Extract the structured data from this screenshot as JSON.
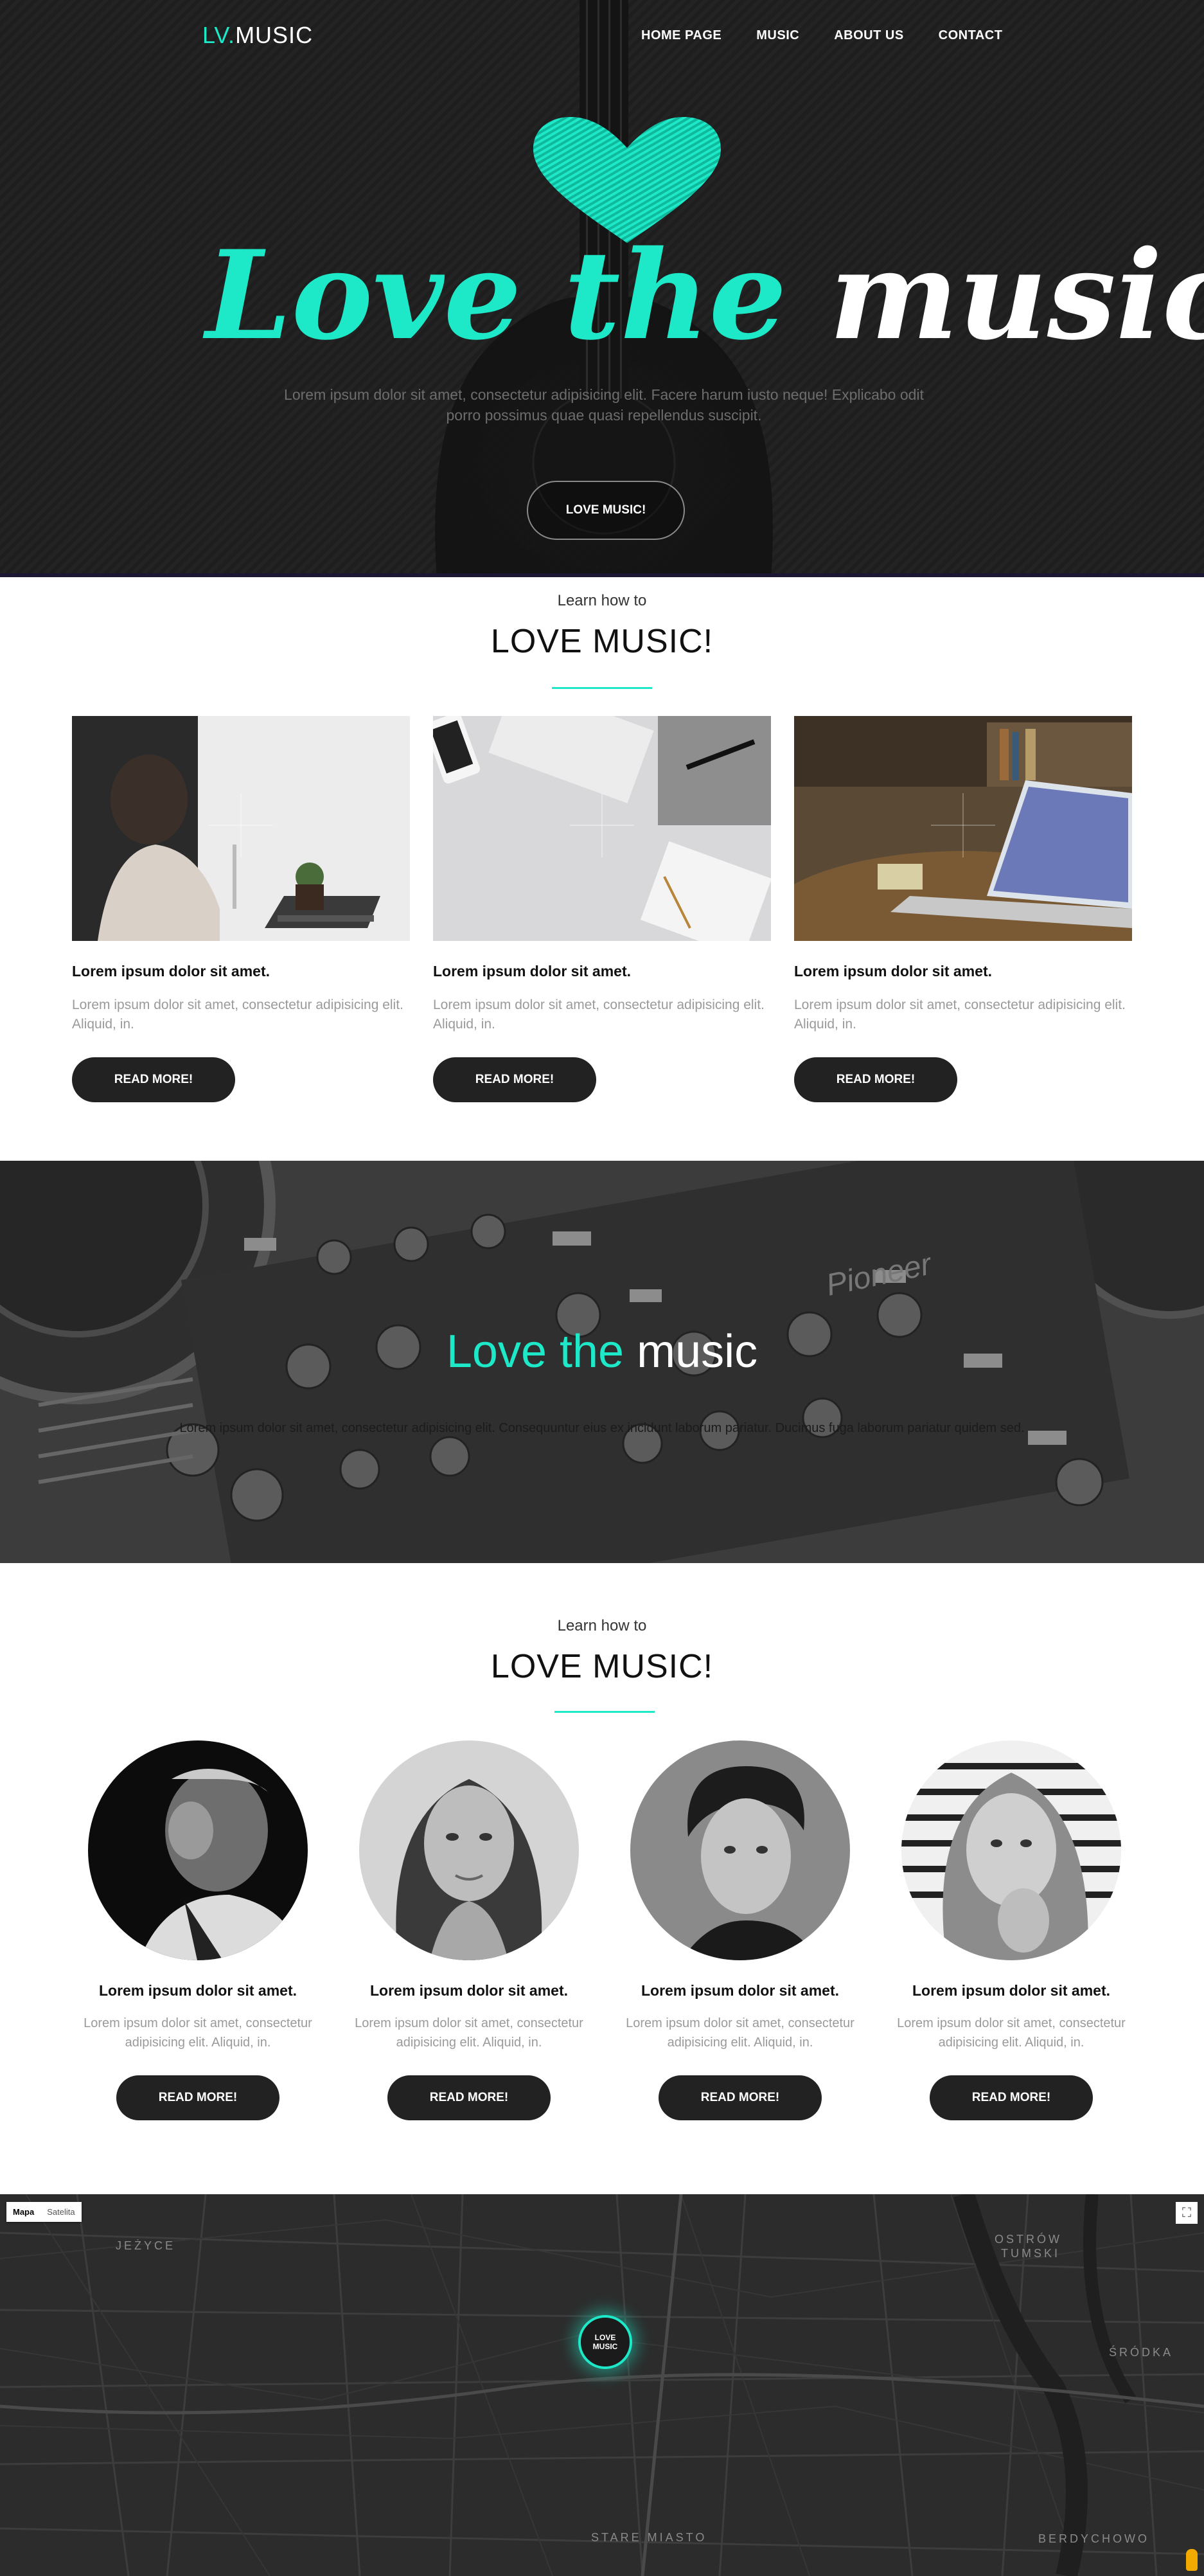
{
  "header": {
    "logo_accent": "LV.",
    "logo_rest": "MUSIC",
    "nav": [
      "HOME PAGE",
      "MUSIC",
      "ABOUT US",
      "CONTACT"
    ]
  },
  "hero": {
    "title_teal": "Love the",
    "title_white": "music",
    "subtitle_line1": "Lorem ipsum dolor sit amet, consectetur adipisicing elit. Facere harum iusto neque! Explicabo odit",
    "subtitle_line2": "porro possimus quae quasi repellendus suscipit.",
    "button": "LOVE MUSIC!"
  },
  "section1": {
    "kicker": "Learn how to",
    "title": "LOVE MUSIC!",
    "cards": [
      {
        "title": "Lorem ipsum dolor sit amet.",
        "text": "Lorem ipsum dolor sit amet, consectetur adipisicing elit. Aliquid, in.",
        "button": "READ MORE!"
      },
      {
        "title": "Lorem ipsum dolor sit amet.",
        "text": "Lorem ipsum dolor sit amet, consectetur adipisicing elit. Aliquid, in.",
        "button": "READ MORE!"
      },
      {
        "title": "Lorem ipsum dolor sit amet.",
        "text": "Lorem ipsum dolor sit amet, consectetur adipisicing elit. Aliquid, in.",
        "button": "READ MORE!"
      }
    ]
  },
  "banner": {
    "title_teal": "Love the",
    "title_white": "music",
    "subtitle": "Lorem ipsum dolor sit amet, consectetur adipisicing elit. Consequuntur eius ex incidunt laborum pariatur. Ducimus fuga laborum pariatur quidem sed."
  },
  "section2": {
    "kicker": "Learn how to",
    "title": "LOVE MUSIC!",
    "people": [
      {
        "title": "Lorem ipsum dolor sit amet.",
        "text_line1": "Lorem ipsum dolor sit amet, consectetur",
        "text_line2": "adipisicing elit. Aliquid, in.",
        "button": "READ MORE!"
      },
      {
        "title": "Lorem ipsum dolor sit amet.",
        "text_line1": "Lorem ipsum dolor sit amet, consectetur",
        "text_line2": "adipisicing elit. Aliquid, in.",
        "button": "READ MORE!"
      },
      {
        "title": "Lorem ipsum dolor sit amet.",
        "text_line1": "Lorem ipsum dolor sit amet, consectetur",
        "text_line2": "adipisicing elit. Aliquid, in.",
        "button": "READ MORE!"
      },
      {
        "title": "Lorem ipsum dolor sit amet.",
        "text_line1": "Lorem ipsum dolor sit amet, consectetur",
        "text_line2": "adipisicing elit. Aliquid, in.",
        "button": "READ MORE!"
      }
    ]
  },
  "map": {
    "type_map": "Mapa",
    "type_satellite": "Satelita",
    "marker_line1": "LOVE",
    "marker_line2": "MUSIC",
    "labels": [
      "JEŻYCE",
      "OSTRÓW",
      "TUMSKI",
      "ŚRÓDKA",
      "STARE MIASTO",
      "BERDYCHOWO"
    ]
  },
  "colors": {
    "accent": "#1de9c8",
    "dark": "#222222",
    "hero_bg": "#1f1f1f"
  }
}
